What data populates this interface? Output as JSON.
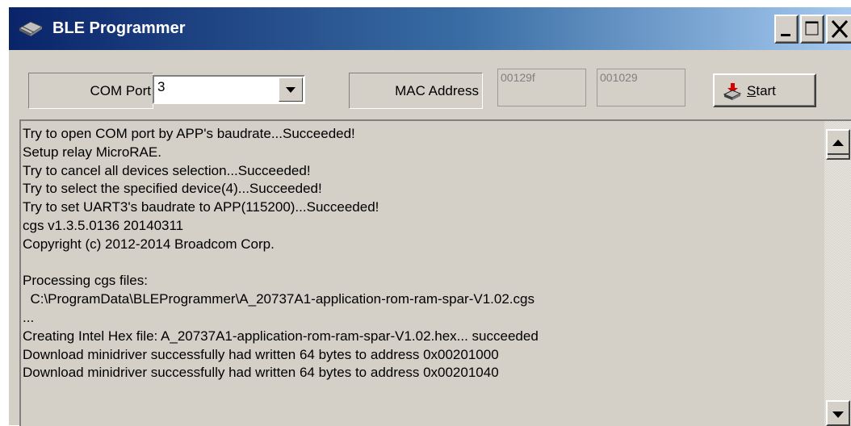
{
  "window": {
    "title": "BLE Programmer",
    "icon": "chip-icon",
    "controls": {
      "minimize": "minimize-icon",
      "maximize": "maximize-icon",
      "close": "close-icon"
    }
  },
  "toolbar": {
    "com_port_label": "COM Port",
    "com_port_value": "3",
    "mac_address_label": "MAC Address",
    "mac_part1": "00129f",
    "mac_part2": "001029",
    "start_label_underlined": "S",
    "start_label_rest": "tart",
    "start_icon": "download-chip-icon"
  },
  "log": {
    "lines": [
      "Try to open COM port by APP's baudrate...Succeeded!",
      "Setup relay MicroRAE.",
      "Try to cancel all devices selection...Succeeded!",
      "Try to select the specified device(4)...Succeeded!",
      "Try to set UART3's baudrate to APP(115200)...Succeeded!",
      "cgs v1.3.5.0136 20140311",
      "Copyright (c) 2012-2014 Broadcom Corp.",
      "",
      "Processing cgs files:",
      "  C:\\ProgramData\\BLEProgrammer\\A_20737A1-application-rom-ram-spar-V1.02.cgs",
      "...",
      "Creating Intel Hex file: A_20737A1-application-rom-ram-spar-V1.02.hex... succeeded",
      "Download minidriver successfully had written 64 bytes to address 0x00201000",
      "Download minidriver successfully had written 64 bytes to address 0x00201040"
    ]
  },
  "colors": {
    "titlebar_start": "#0a246a",
    "titlebar_end": "#a6caf0",
    "face": "#d4d0c8"
  }
}
